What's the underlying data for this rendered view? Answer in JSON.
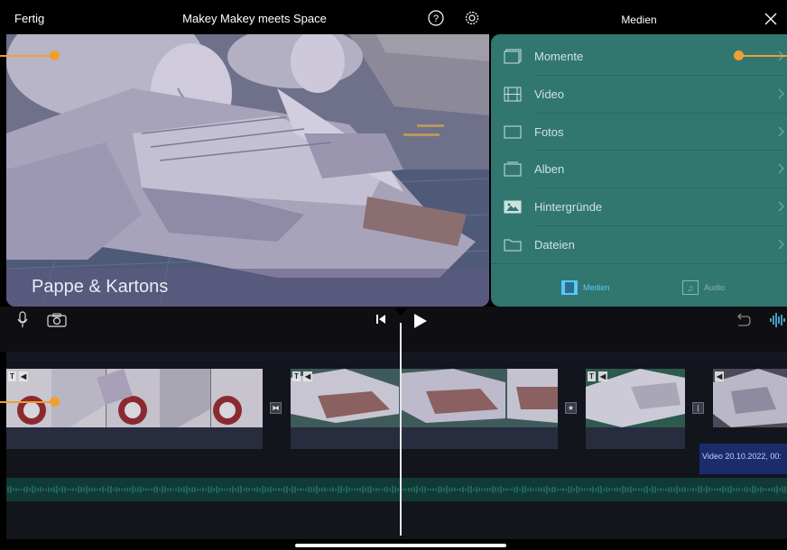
{
  "topbar": {
    "done_label": "Fertig",
    "project_title": "Makey Makey meets Space",
    "help_icon": "question-circle-icon",
    "settings_icon": "gear-icon"
  },
  "preview": {
    "caption": "Pappe & Kartons"
  },
  "media_panel": {
    "title": "Medien",
    "close_icon": "close-icon",
    "items": [
      {
        "label": "Momente",
        "icon": "moments-icon"
      },
      {
        "label": "Video",
        "icon": "film-icon"
      },
      {
        "label": "Fotos",
        "icon": "photo-frame-icon"
      },
      {
        "label": "Alben",
        "icon": "album-icon"
      },
      {
        "label": "Hintergründe",
        "icon": "landscape-icon"
      },
      {
        "label": "Dateien",
        "icon": "folder-icon"
      }
    ],
    "tabs": [
      {
        "label": "Medien",
        "icon": "film-strip-icon",
        "active": true
      },
      {
        "label": "Audio",
        "icon": "music-note-icon",
        "active": false
      }
    ]
  },
  "controls": {
    "mic_icon": "microphone-icon",
    "camera_icon": "camera-icon",
    "skip_back_icon": "skip-to-start-icon",
    "play_icon": "play-icon",
    "undo_icon": "undo-icon",
    "waveform_icon": "audio-waveform-icon"
  },
  "timeline": {
    "transitions": [
      "⧓",
      "★",
      "|"
    ],
    "audio_clip_label": "Video 20.10.2022, 00:"
  },
  "colors": {
    "accent_orange": "#f0a030",
    "media_panel_bg": "#317770",
    "active_tab": "#5ac8fa",
    "audio_track": "#103a36",
    "audio_label_bg": "#1a2c6a"
  }
}
